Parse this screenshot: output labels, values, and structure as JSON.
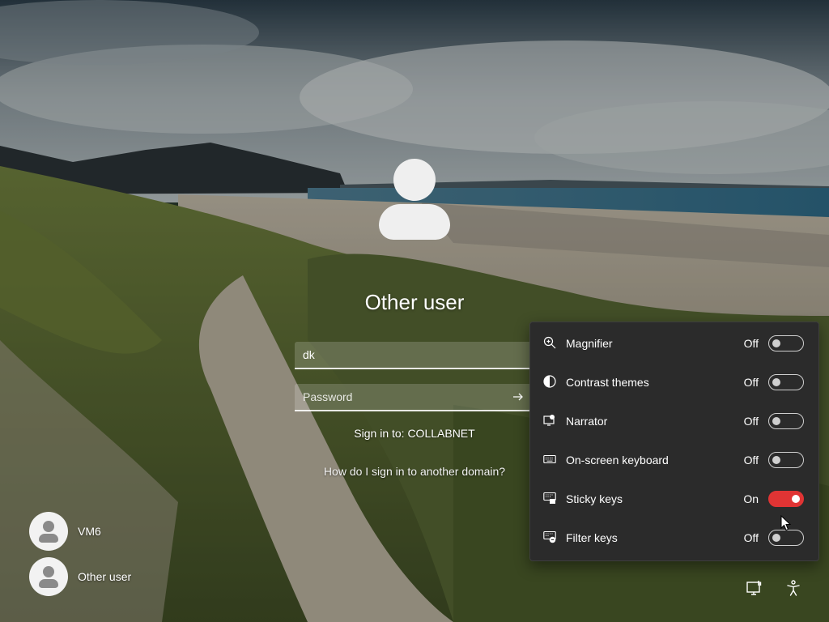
{
  "colors": {
    "flyout_bg": "#2b2b2b",
    "toggle_on": "#e03434",
    "text": "#ffffff"
  },
  "signin": {
    "avatar_icon": "user-silhouette-icon",
    "title": "Other user",
    "username_value": "dk",
    "password_placeholder": "Password",
    "submit_icon": "arrow-right-icon",
    "sign_in_to": "Sign in to: COLLABNET",
    "other_domain_link": "How do I sign in to another domain?"
  },
  "users": [
    {
      "name": "VM6",
      "icon": "user-avatar-icon"
    },
    {
      "name": "Other user",
      "icon": "user-avatar-icon"
    }
  ],
  "accessibility": {
    "items": [
      {
        "label": "Magnifier",
        "state": "Off",
        "on": false,
        "icon": "magnifier-icon"
      },
      {
        "label": "Contrast themes",
        "state": "Off",
        "on": false,
        "icon": "contrast-icon"
      },
      {
        "label": "Narrator",
        "state": "Off",
        "on": false,
        "icon": "narrator-icon"
      },
      {
        "label": "On-screen keyboard",
        "state": "Off",
        "on": false,
        "icon": "keyboard-icon"
      },
      {
        "label": "Sticky keys",
        "state": "On",
        "on": true,
        "icon": "sticky-keys-icon"
      },
      {
        "label": "Filter keys",
        "state": "Off",
        "on": false,
        "icon": "filter-keys-icon"
      }
    ]
  },
  "tray": {
    "network_icon": "network-icon",
    "accessibility_icon": "accessibility-icon"
  }
}
